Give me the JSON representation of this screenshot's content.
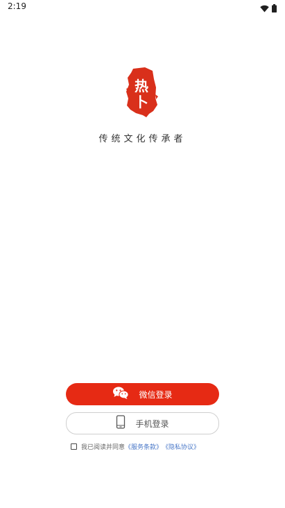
{
  "status_bar": {
    "time": "2:19",
    "icons": [
      "wifi-icon",
      "battery-icon"
    ]
  },
  "logo": {
    "seal_text": "热卜",
    "seal_color": "#d9301b"
  },
  "slogan": "传统文化传承者",
  "buttons": {
    "wechat_login": "微信登录",
    "phone_login": "手机登录"
  },
  "agreement": {
    "checked": false,
    "prefix": "我已阅读并同意",
    "service_terms": "《服务条款》",
    "privacy_policy": "《隐私协议》"
  },
  "colors": {
    "accent": "#e62a14",
    "link": "#4a78c8"
  }
}
